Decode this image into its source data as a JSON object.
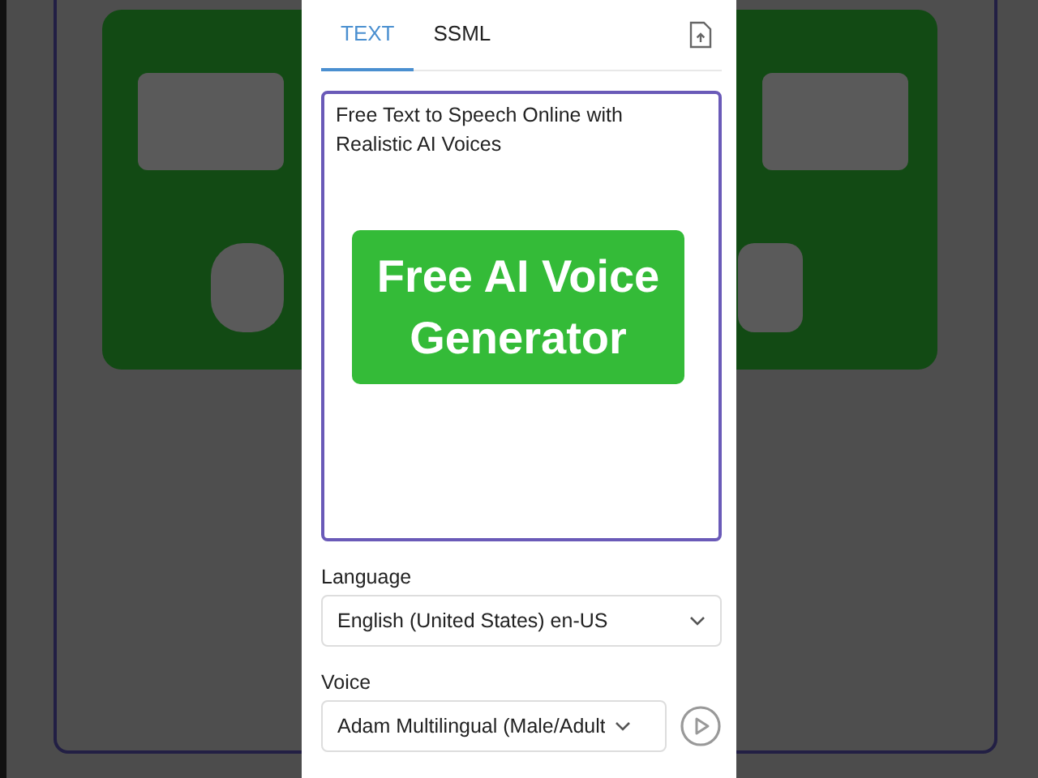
{
  "tabs": [
    {
      "label": "TEXT",
      "selected": true
    },
    {
      "label": "SSML",
      "selected": false
    }
  ],
  "text_input": {
    "value": "Free Text to Speech Online with Realistic AI Voices"
  },
  "banner": {
    "lines": [
      "Free AI Voice",
      "Generator"
    ]
  },
  "language": {
    "label": "Language",
    "value": "English (United States) en-US"
  },
  "voice": {
    "label": "Voice",
    "value": "Adam Multilingual (Male/Adult"
  }
}
